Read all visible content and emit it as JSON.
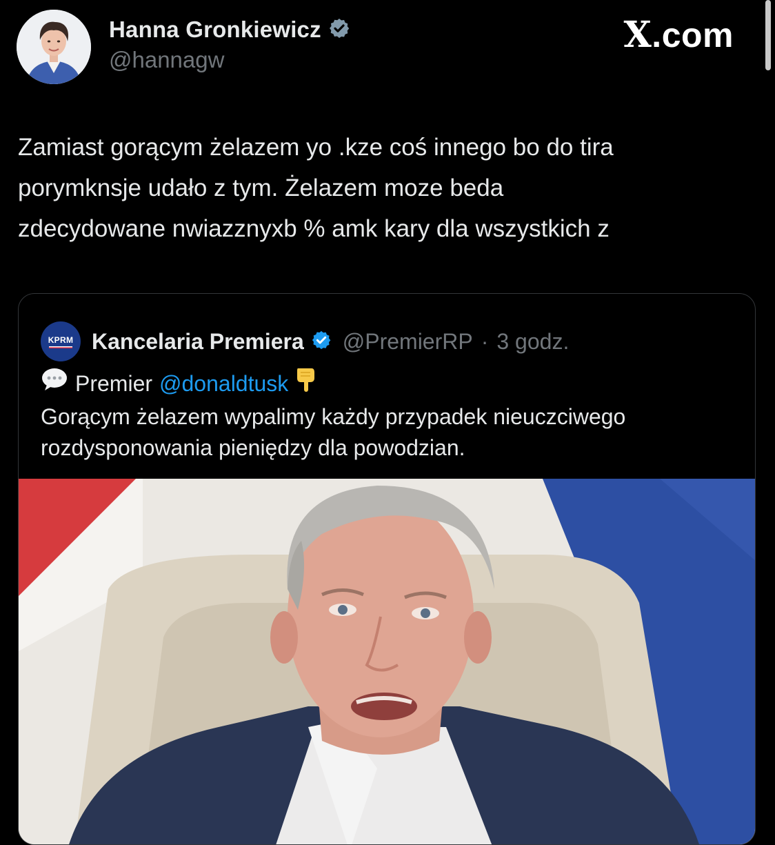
{
  "author": {
    "name": "Hanna Gronkiewicz",
    "handle": "@hannagw",
    "verified_color": "#829aab"
  },
  "brand": {
    "label_x": "X",
    "label_rest": ".com"
  },
  "tweet": {
    "text": "Zamiast gorącym żelazem yo .kze coś innego bo do tira\nporymknsje udało z tym. Żelazem moze beda\nzdecydowane nwiazznyxb %  amk kary dla wszystkich z"
  },
  "quoted": {
    "logo_text": "KPRM",
    "name": "Kancelaria Premiera",
    "handle": "@PremierRP",
    "separator": "·",
    "time": "3 godz.",
    "verified_color": "#1d9bf0",
    "prefix_icon": "speech-bubble-icon",
    "prefix": "Premier",
    "mention": "@donaldtusk",
    "suffix_icon": "pointing-down-hand-icon",
    "body": "Gorącym żelazem wypalimy każdy przypadek nieuczciwego rozdysponowania pieniędzy dla powodzian."
  },
  "colors": {
    "background": "#000000",
    "text": "#e7e9ea",
    "secondary": "#71767b",
    "link": "#1d9bf0",
    "border": "#333639"
  }
}
